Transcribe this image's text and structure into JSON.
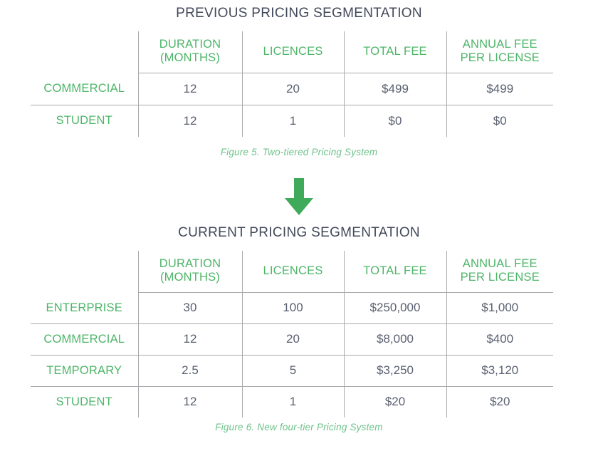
{
  "colors": {
    "green": "#4cb567",
    "caption_green": "#6ec28a",
    "title_dark": "#41495a",
    "value_gray": "#5a6070",
    "rule_gray": "#a7a9ac",
    "arrow_green": "#3faa5a",
    "background": "#ffffff"
  },
  "previous_section": {
    "title": "PREVIOUS PRICING SEGMENTATION",
    "caption": "Figure 5. Two-tiered Pricing System",
    "table": {
      "corner_label": "",
      "headers": [
        {
          "line1": "DURATION",
          "line2": "(MONTHS)"
        },
        {
          "line1": "LICENCES",
          "line2": ""
        },
        {
          "line1": "TOTAL FEE",
          "line2": ""
        },
        {
          "line1": "ANNUAL FEE",
          "line2": "PER LICENSE"
        }
      ],
      "rows": [
        {
          "label": "COMMERCIAL",
          "duration": "12",
          "licences": "20",
          "total_fee": "$499",
          "annual_fee_per_license": "$499"
        },
        {
          "label": "STUDENT",
          "duration": "12",
          "licences": "1",
          "total_fee": "$0",
          "annual_fee_per_license": "$0"
        }
      ]
    }
  },
  "arrow": {
    "icon": "arrow-down-icon",
    "direction": "down"
  },
  "current_section": {
    "title": "CURRENT PRICING SEGMENTATION",
    "caption": "Figure 6. New four-tier Pricing System",
    "table": {
      "corner_label": "",
      "headers": [
        {
          "line1": "DURATION",
          "line2": "(MONTHS)"
        },
        {
          "line1": "LICENCES",
          "line2": ""
        },
        {
          "line1": "TOTAL FEE",
          "line2": ""
        },
        {
          "line1": "ANNUAL FEE",
          "line2": "PER LICENSE"
        }
      ],
      "rows": [
        {
          "label": "ENTERPRISE",
          "duration": "30",
          "licences": "100",
          "total_fee": "$250,000",
          "annual_fee_per_license": "$1,000"
        },
        {
          "label": "COMMERCIAL",
          "duration": "12",
          "licences": "20",
          "total_fee": "$8,000",
          "annual_fee_per_license": "$400"
        },
        {
          "label": "TEMPORARY",
          "duration": "2.5",
          "licences": "5",
          "total_fee": "$3,250",
          "annual_fee_per_license": "$3,120"
        },
        {
          "label": "STUDENT",
          "duration": "12",
          "licences": "1",
          "total_fee": "$20",
          "annual_fee_per_license": "$20"
        }
      ]
    }
  }
}
